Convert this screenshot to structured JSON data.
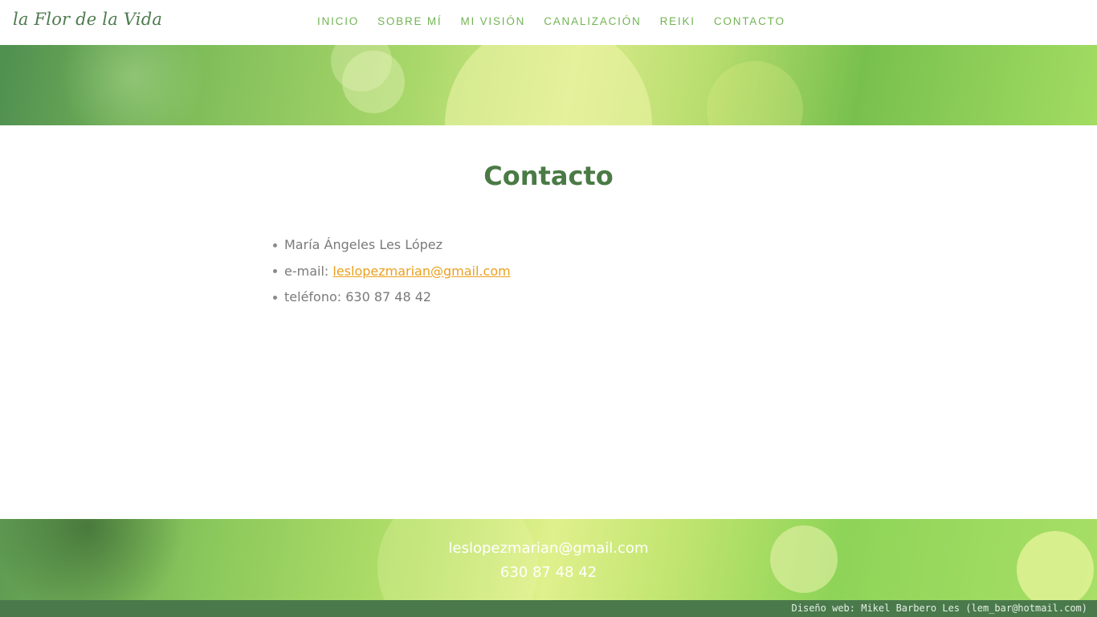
{
  "header": {
    "logo": "la Flor de la Vida",
    "nav": [
      "INICIO",
      "SOBRE MÍ",
      "MI VISIÓN",
      "CANALIZACIÓN",
      "REIKI",
      "CONTACTO"
    ]
  },
  "main": {
    "title": "Contacto",
    "name": "María Ángeles Les López",
    "email_label": "e-mail: ",
    "email": "leslopezmarian@gmail.com",
    "phone_label": "teléfono: ",
    "phone": "630 87 48 42"
  },
  "footer": {
    "email": "leslopezmarian@gmail.com",
    "phone": "630 87 48 42",
    "credit": "Diseño web: Mikel Barbero Les (lem_bar@hotmail.com)"
  },
  "colors": {
    "accent": "#72b454",
    "title": "#4a7a45",
    "link": "#eba01e",
    "credit_bar": "#4a7a4b"
  }
}
